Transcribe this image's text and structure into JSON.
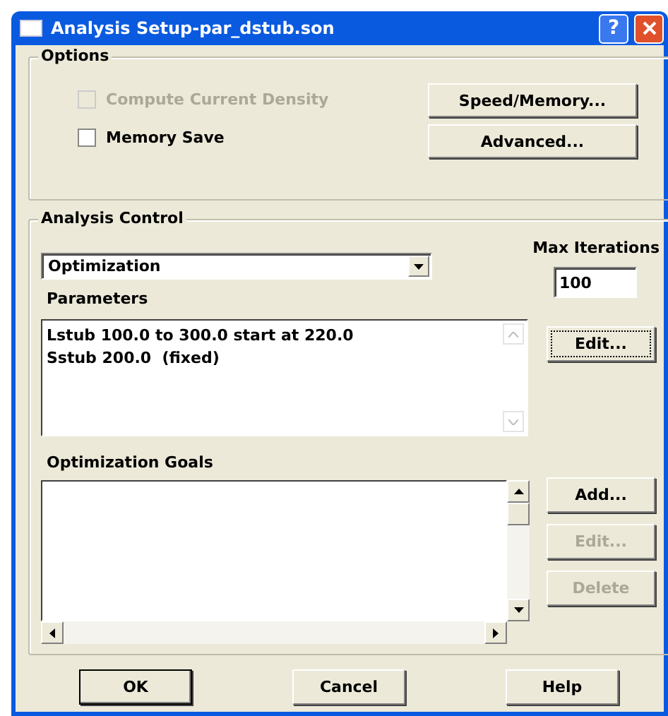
{
  "window": {
    "title": "Analysis Setup-par_dstub.son",
    "help_button": "?"
  },
  "options": {
    "title": "Options",
    "checkboxes": [
      {
        "label": "Compute Current Density",
        "checked": false,
        "disabled": true
      },
      {
        "label": "Memory Save",
        "checked": false,
        "disabled": false
      }
    ],
    "buttons": [
      "Speed/Memory...",
      "Advanced..."
    ]
  },
  "analysis_control": {
    "title": "Analysis Control",
    "mode": "Optimization",
    "max_iterations_label": "Max Iterations",
    "max_iterations": "100",
    "parameters_label": "Parameters",
    "parameters": [
      "Lstub 100.0 to 300.0 start at 220.0",
      "Sstub 200.0  (fixed)"
    ],
    "parameters_button": {
      "label": "Edit...",
      "focused": true
    },
    "goals_label": "Optimization Goals",
    "goals_buttons": [
      {
        "label": "Add...",
        "disabled": false
      },
      {
        "label": "Edit...",
        "disabled": true
      },
      {
        "label": "Delete",
        "disabled": true
      }
    ]
  },
  "buttons": [
    {
      "label": "OK",
      "default": true
    },
    {
      "label": "Cancel",
      "default": false
    },
    {
      "label": "Help",
      "default": false
    }
  ]
}
